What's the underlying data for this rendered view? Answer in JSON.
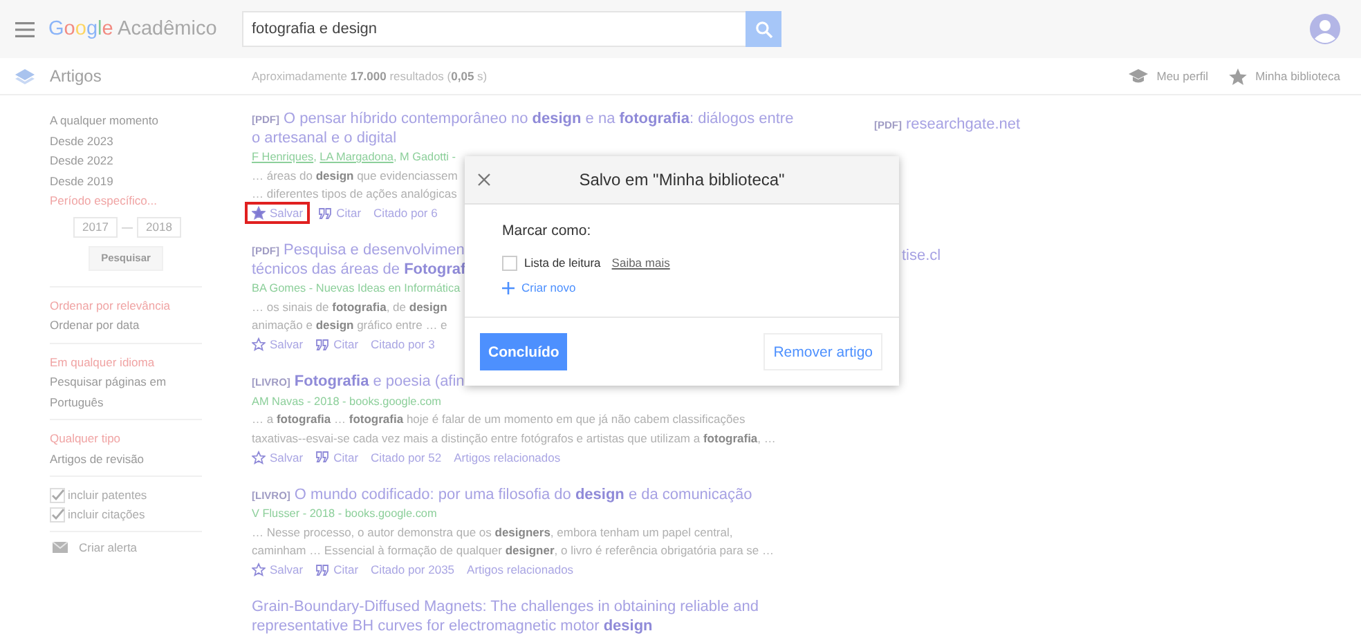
{
  "header": {
    "logo_brand": "Google",
    "logo_product": "Acadêmico",
    "search": {
      "value": "fotografia e design"
    }
  },
  "subheader": {
    "section": "Artigos",
    "results_count": "Aproximadamente **17.000** resultados (**0,05** s)",
    "links": [
      {
        "kind": "profile",
        "label": "Meu perfil"
      },
      {
        "kind": "library",
        "label": "Minha biblioteca"
      }
    ]
  },
  "sidebar": {
    "groups": [
      {
        "items": [
          {
            "label": "A qualquer momento",
            "selected": false
          },
          {
            "label": "Desde 2023",
            "selected": false
          },
          {
            "label": "Desde 2022",
            "selected": false
          },
          {
            "label": "Desde 2019",
            "selected": false
          },
          {
            "label": "Período específico...",
            "selected": true
          }
        ],
        "date_range": {
          "from": "2017",
          "to": "2018",
          "separator": "—",
          "button": "Pesquisar"
        }
      },
      {
        "items": [
          {
            "label": "Ordenar por relevância",
            "selected": true
          },
          {
            "label": "Ordenar por data",
            "selected": false
          }
        ]
      },
      {
        "items": [
          {
            "label": "Em qualquer idioma",
            "selected": true
          },
          {
            "label": "Pesquisar páginas em Português",
            "selected": false
          }
        ]
      },
      {
        "items": [
          {
            "label": "Qualquer tipo",
            "selected": true
          },
          {
            "label": "Artigos de revisão",
            "selected": false
          }
        ]
      }
    ],
    "options": [
      {
        "label": "incluir patentes",
        "checked": true
      },
      {
        "label": "incluir citações",
        "checked": true
      }
    ],
    "alert": "Criar alerta"
  },
  "results": [
    {
      "tag": "[PDF]",
      "title_lines": [
        "O pensar híbrido contemporâneo no **design** e na **fotografia**: diálogos entre",
        "o artesanal e o digital"
      ],
      "authors": [
        {
          "text": "F Henriques",
          "linked": true,
          "after": ", "
        },
        {
          "text": "LA Margadona",
          "linked": true,
          "after": ", "
        },
        {
          "text": "M Gadotti -",
          "linked": false
        }
      ],
      "snippets": [
        "… áreas do **design** que evidenciassem",
        "… diferentes tipos de ações analógicas"
      ],
      "actions": [
        {
          "kind": "save",
          "label": "Salvar",
          "saved": true,
          "highlighted": true
        },
        {
          "kind": "cite",
          "label": "Citar"
        },
        {
          "kind": "link",
          "label": "Citado por 6"
        }
      ],
      "side_tag": "[PDF]",
      "side_link": "researchgate.net"
    },
    {
      "tag": "[PDF]",
      "title_lines": [
        "Pesquisa e desenvolvimen",
        "técnicos das áreas de **Fotograf**"
      ],
      "authors": [
        {
          "text": "BA Gomes - Nuevas Ideas en Informática",
          "linked": false
        }
      ],
      "snippets": [
        "… os sinais de **fotografia**, de **design**",
        "animação e **design** gráfico entre … e"
      ],
      "actions": [
        {
          "kind": "save",
          "label": "Salvar",
          "saved": false,
          "highlighted": false
        },
        {
          "kind": "cite",
          "label": "Citar"
        },
        {
          "kind": "link",
          "label": "Citado por 3"
        }
      ],
      "side_link": "tise.cl"
    },
    {
      "tag": "[LIVRO]",
      "title_lines": [
        "**Fotografia** e poesia (afin"
      ],
      "authors": [
        {
          "text": "AM Navas - 2018 - books.google.com",
          "linked": false
        }
      ],
      "snippets": [
        "… a **fotografia** … **fotografia** hoje é falar de um momento em que já não cabem classificações",
        "taxativas--esvai-se cada vez mais a distinção entre fotógrafos e artistas que utilizam a **fotografia**, …"
      ],
      "actions": [
        {
          "kind": "save",
          "label": "Salvar",
          "saved": false,
          "highlighted": false
        },
        {
          "kind": "cite",
          "label": "Citar"
        },
        {
          "kind": "link",
          "label": "Citado por 52"
        },
        {
          "kind": "link",
          "label": "Artigos relacionados"
        }
      ]
    },
    {
      "tag": "[LIVRO]",
      "title_lines": [
        "O mundo codificado: por uma filosofia do **design** e da comunicação"
      ],
      "authors": [
        {
          "text": "V Flusser - 2018 - books.google.com",
          "linked": false
        }
      ],
      "snippets": [
        "… Nesse processo, o autor demonstra que os **designers**, embora tenham um papel central,",
        "caminham … Essencial à formação de qualquer **designer**, o livro é referência obrigatória para se …"
      ],
      "actions": [
        {
          "kind": "save",
          "label": "Salvar",
          "saved": false,
          "highlighted": false
        },
        {
          "kind": "cite",
          "label": "Citar"
        },
        {
          "kind": "link",
          "label": "Citado por 2035"
        },
        {
          "kind": "link",
          "label": "Artigos relacionados"
        }
      ]
    },
    {
      "title_lines": [
        "Grain-Boundary-Diffused Magnets: The challenges in obtaining reliable and",
        "representative BH curves for electromagnetic motor **design**"
      ]
    }
  ],
  "dialog": {
    "title": "Salvo em \"Minha biblioteca\"",
    "label": "Marcar como:",
    "lists": [
      {
        "label": "Lista de leitura",
        "checked": false,
        "link": "Saiba mais"
      }
    ],
    "create": "Criar novo",
    "primary": "Concluído",
    "secondary": "Remover artigo"
  }
}
